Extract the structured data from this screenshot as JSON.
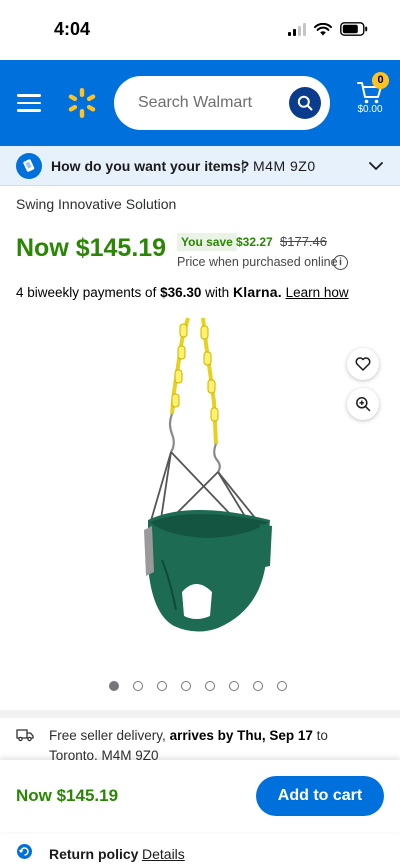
{
  "status_bar": {
    "time": "4:04"
  },
  "header": {
    "search_placeholder": "Search Walmart",
    "cart_count": "0",
    "cart_total": "$0.00",
    "brand_color": "#0071dc",
    "spark_color": "#ffc220"
  },
  "delivery": {
    "question": "How do you want your items?",
    "separator": "|",
    "postal_code": "M4M 9Z0"
  },
  "product": {
    "seller": "Swing Innovative Solution",
    "price_now": "Now $145.19",
    "you_save_label": "You save",
    "you_save_amount": "$32.27",
    "was_price": "$177.46",
    "price_note": "Price when purchased online",
    "installments_prefix": "4 biweekly payments of",
    "installment_amount": "$36.30",
    "installments_with": "with",
    "klarna": "Klarna.",
    "learn_how": "Learn how",
    "image_count": 8,
    "active_image": 1
  },
  "shipping": {
    "prefix": "Free seller delivery,",
    "arrival": "arrives by Thu, Sep 17",
    "to": "to",
    "destination": "Toronto, M4M 9Z0"
  },
  "sticky_bar": {
    "price": "Now $145.19",
    "add_to_cart": "Add to cart"
  },
  "return_policy": {
    "label": "Return policy",
    "details": "Details"
  },
  "icons": {
    "menu": "hamburger-icon",
    "search": "search-icon",
    "cart": "cart-icon",
    "favorite": "heart-icon",
    "zoom": "zoom-in-icon",
    "info": "info-icon",
    "delivery": "truck-icon",
    "chevron": "chevron-down-icon"
  }
}
